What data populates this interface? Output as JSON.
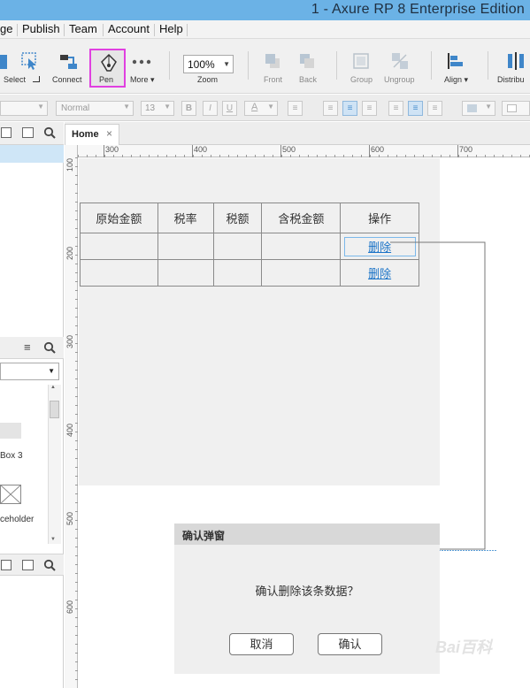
{
  "window": {
    "title": "1 - Axure RP 8 Enterprise Edition"
  },
  "menu": {
    "items": [
      "ge",
      "Publish",
      "Team",
      "Account",
      "Help"
    ]
  },
  "toolbar": {
    "select_label": "Select",
    "connect_label": "Connect",
    "pen_label": "Pen",
    "more_label": "More ▾",
    "zoom_value": "100%",
    "zoom_label": "Zoom",
    "front_label": "Front",
    "back_label": "Back",
    "group_label": "Group",
    "ungroup_label": "Ungroup",
    "align_label": "Align ▾",
    "distribute_label": "Distribu"
  },
  "formatbar": {
    "style_value": "Normal",
    "size_value": "13"
  },
  "left_panel": {
    "item1_label": "Box 3",
    "item2_label": "ceholder"
  },
  "tabs": {
    "home_label": "Home",
    "close_glyph": "×"
  },
  "ruler": {
    "top": [
      "300",
      "400",
      "500",
      "600",
      "700"
    ],
    "left": [
      "100",
      "200",
      "300",
      "400",
      "500",
      "600"
    ]
  },
  "table": {
    "headers": [
      "原始金额",
      "税率",
      "税额",
      "含税金额",
      "操作"
    ],
    "delete_label": "删除"
  },
  "dialog": {
    "title": "确认弹窗",
    "message": "确认删除该条数据？",
    "cancel_label": "取消",
    "confirm_label": "确认"
  },
  "watermark": {
    "text": "Bai百科"
  },
  "colors": {
    "accent": "#6bb2e6",
    "link": "#1a73c7",
    "pen_highlight": "#e040e0"
  }
}
